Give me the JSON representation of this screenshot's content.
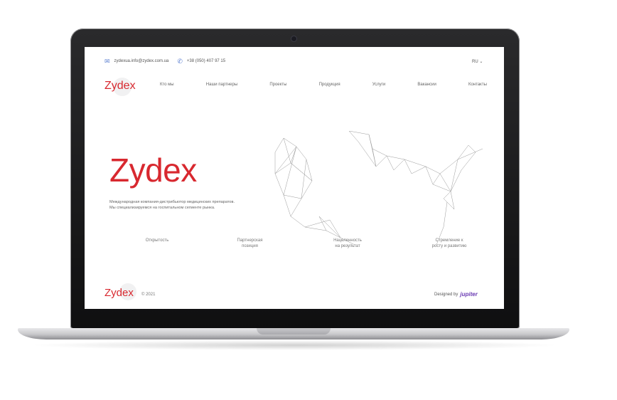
{
  "topbar": {
    "email": "zydexua.info@zydex.com.ua",
    "phone": "+38 (050) 407 97 15",
    "email_icon": "envelope-icon",
    "phone_icon": "phone-icon",
    "language": "RU"
  },
  "brand": {
    "logo": "Zydex",
    "accent_color": "#d8282f"
  },
  "nav": {
    "items": [
      "Кто мы",
      "Наши партнеры",
      "Проекты",
      "Продукция",
      "Услуги",
      "Вакансии",
      "Контакты"
    ]
  },
  "hero": {
    "title": "Zydex",
    "description_line1": "Международная компания-дистрибьютор медицинских препаратов.",
    "description_line2": "Мы специализируемся на госпитальном сегменте рынка."
  },
  "values": [
    {
      "line1": "Открытость",
      "line2": ""
    },
    {
      "line1": "Партнерская",
      "line2": "позиция"
    },
    {
      "line1": "Нацеленность",
      "line2": "на результат"
    },
    {
      "line1": "Стремление к",
      "line2": "росту и развитию"
    }
  ],
  "footer": {
    "logo": "Zydex",
    "copyright": "© 2021",
    "designed_by": "Designed by",
    "agency": "jupiter"
  }
}
